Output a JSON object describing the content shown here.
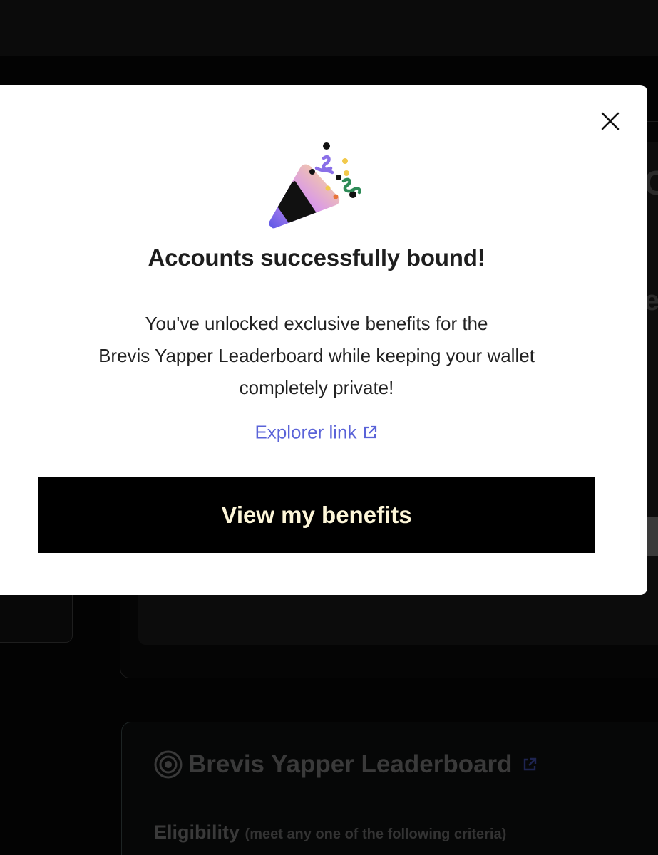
{
  "modal": {
    "title": "Accounts successfully bound!",
    "body_line1": "You've unlocked exclusive benefits for the",
    "body_line2": "Brevis Yapper Leaderboard while keeping your wallet",
    "body_line3": "completely private!",
    "explorer_link_label": "Explorer link",
    "cta_label": "View my benefits",
    "close_icon": "close-icon",
    "illustration": "party-popper-icon",
    "accent_color": "#5a63d8",
    "button_text_color": "#fdf6d8"
  },
  "background": {
    "leaderboard_title": "Brevis Yapper Leaderboard",
    "eligibility_label": "Eligibility",
    "eligibility_note": "(meet any one of the following criteria)"
  }
}
